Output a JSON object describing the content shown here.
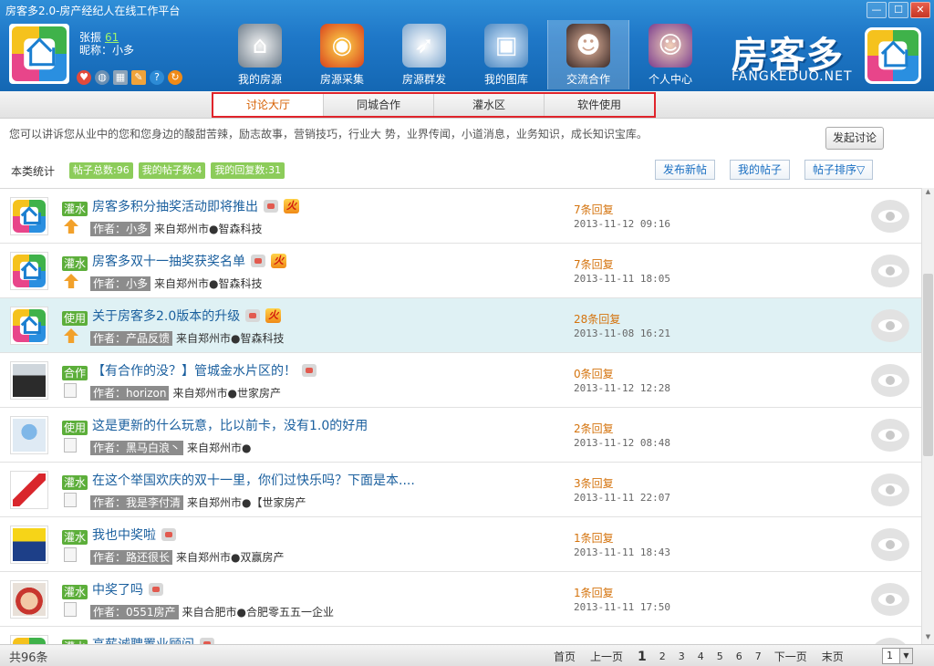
{
  "window": {
    "title": "房客多2.0-房产经纪人在线工作平台",
    "controls": [
      "—",
      "☐",
      "✕"
    ]
  },
  "user": {
    "name": "张振",
    "score": "61",
    "nick_label": "昵称：小多"
  },
  "nav": [
    {
      "label": "我的房源",
      "icon": "house-icon",
      "active": false
    },
    {
      "label": "房源采集",
      "icon": "toy-car-icon",
      "active": false
    },
    {
      "label": "房源群发",
      "icon": "rocket-icon",
      "active": false
    },
    {
      "label": "我的图库",
      "icon": "photo-icon",
      "active": false
    },
    {
      "label": "交流合作",
      "icon": "people-icon",
      "active": true
    },
    {
      "label": "个人中心",
      "icon": "person-icon",
      "active": false
    }
  ],
  "brand": {
    "cn": "房客多",
    "en": "FANGKEDUO.NET"
  },
  "subtabs": [
    "讨论大厅",
    "同城合作",
    "灌水区",
    "软件使用"
  ],
  "intro": "您可以讲诉您从业中的您和您身边的酸甜苦辣，励志故事，营销技巧，行业大 势，业界传闻，小道消息，业务知识，成长知识宝库。",
  "start_button": "发起讨论",
  "stats": {
    "label": "本类统计",
    "chips": [
      "帖子总数:96",
      "我的帖子数:4",
      "我的回复数:31"
    ]
  },
  "actions": [
    "发布新帖",
    "我的帖子",
    "帖子排序▽"
  ],
  "posts": [
    {
      "tag": "灌水",
      "pin": "up",
      "title": "房客多积分抽奖活动即将推出",
      "hot": true,
      "author": "作者：小多",
      "from": "来自郑州市●智森科技",
      "replies": "7条回复",
      "date": "2013-11-12 09:16",
      "avatar": "logo"
    },
    {
      "tag": "灌水",
      "pin": "up",
      "title": "房客多双十一抽奖获奖名单",
      "hot": true,
      "author": "作者：小多",
      "from": "来自郑州市●智森科技",
      "replies": "7条回复",
      "date": "2013-11-11 18:05",
      "avatar": "logo"
    },
    {
      "tag": "使用",
      "pin": "up",
      "title": "关于房客多2.0版本的升级",
      "hot": true,
      "author": "作者：产品反馈",
      "from": "来自郑州市●智森科技",
      "replies": "28条回复",
      "date": "2013-11-08 16:21",
      "avatar": "logo",
      "highlight": true
    },
    {
      "tag": "合作",
      "pin": "doc",
      "title": "【有合作的没？】管城金水片区的！",
      "hot": false,
      "author": "作者：horizon",
      "from": "来自郑州市●世家房产",
      "replies": "0条回复",
      "date": "2013-11-12 12:28",
      "avatar": "person-dark"
    },
    {
      "tag": "使用",
      "pin": "doc",
      "title": "这是更新的什么玩意，比以前卡，没有1.0的好用",
      "hot": false,
      "bubble": false,
      "author": "作者：黑马白浪丶",
      "from": "来自郑州市●",
      "replies": "2条回复",
      "date": "2013-11-12 08:48",
      "avatar": "default-blue"
    },
    {
      "tag": "灌水",
      "pin": "doc",
      "title": "在这个举国欢庆的双十一里，你们过快乐吗？下面是本....",
      "hot": false,
      "bubble": false,
      "author": "作者：我是李付清",
      "from": "来自郑州市●【世家房产",
      "replies": "3条回复",
      "date": "2013-11-11 22:07",
      "avatar": "logo-red"
    },
    {
      "tag": "灌水",
      "pin": "doc",
      "title": "我也中奖啦",
      "hot": false,
      "author": "作者：路还很长",
      "from": "来自郑州市●双赢房产",
      "replies": "1条回复",
      "date": "2013-11-11 18:43",
      "avatar": "person-yellow"
    },
    {
      "tag": "灌水",
      "pin": "doc",
      "title": "中奖了吗",
      "hot": false,
      "author": "作者：0551房产",
      "from": "来自合肥市●合肥零五五一企业",
      "replies": "1条回复",
      "date": "2013-11-11 17:50",
      "avatar": "baby"
    },
    {
      "tag": "灌水",
      "pin": "doc",
      "title": "高薪诚聘置业顾问",
      "hot": false,
      "author": "",
      "from": "",
      "replies": "",
      "date": "",
      "avatar": "logo"
    }
  ],
  "footer": {
    "total": "共96条",
    "first": "首页",
    "prev": "上一页",
    "pages": [
      "1",
      "2",
      "3",
      "4",
      "5",
      "6",
      "7"
    ],
    "next": "下一页",
    "last": "末页",
    "selected_page": "1"
  },
  "colors": {
    "header_blue": "#1f78c8",
    "tag_green": "#5cae3a",
    "reply_orange": "#d4730d",
    "title_blue": "#1a5f9e",
    "tab_border_red": "#e0242b"
  }
}
